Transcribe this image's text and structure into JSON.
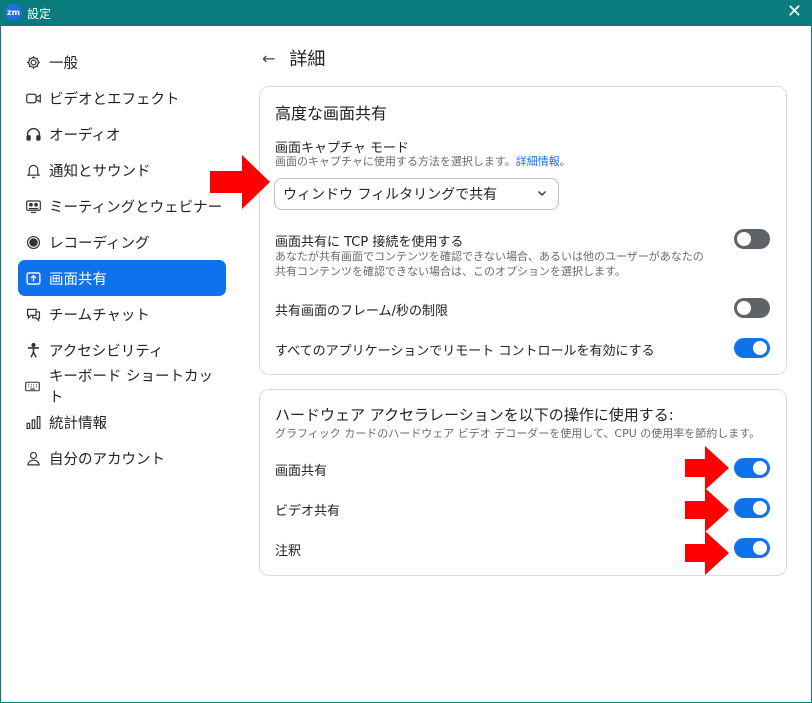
{
  "window": {
    "title": "設定",
    "logo": "zm",
    "close_glyph": "✕"
  },
  "sidebar": {
    "items": [
      {
        "label": "一般",
        "icon": "gear-icon",
        "active": false
      },
      {
        "label": "ビデオとエフェクト",
        "icon": "video-camera-icon",
        "active": false
      },
      {
        "label": "オーディオ",
        "icon": "headphones-icon",
        "active": false
      },
      {
        "label": "通知とサウンド",
        "icon": "bell-icon",
        "active": false
      },
      {
        "label": "ミーティングとウェビナー",
        "icon": "meeting-icon",
        "active": false
      },
      {
        "label": "レコーディング",
        "icon": "record-icon",
        "active": false
      },
      {
        "label": "画面共有",
        "icon": "share-screen-icon",
        "active": true
      },
      {
        "label": "チームチャット",
        "icon": "chat-icon",
        "active": false
      },
      {
        "label": "アクセシビリティ",
        "icon": "accessibility-icon",
        "active": false
      },
      {
        "label": "キーボード ショートカット",
        "icon": "keyboard-icon",
        "active": false
      },
      {
        "label": "統計情報",
        "icon": "stats-icon",
        "active": false
      },
      {
        "label": "自分のアカウント",
        "icon": "user-icon",
        "active": false
      }
    ]
  },
  "header": {
    "back_glyph": "←",
    "title": "詳細"
  },
  "advanced": {
    "title": "高度な画面共有",
    "capture_mode_label": "画面キャプチャ モード",
    "capture_mode_desc": "画面のキャプチャに使用する方法を選択します。",
    "capture_mode_link": "詳細情報",
    "capture_mode_period": "。",
    "capture_mode_value": "ウィンドウ フィルタリングで共有",
    "tcp_label": "画面共有に TCP 接続を使用する",
    "tcp_desc_line1": "あなたが共有画面でコンテンツを確認できない場合、あるいは他のユーザーがあなたの",
    "tcp_desc_line2": "共有コンテンツを確認できない場合は、このオプションを選択します。",
    "tcp_on": false,
    "fps_label": "共有画面のフレーム/秒の制限",
    "fps_on": false,
    "remote_label": "すべてのアプリケーションでリモート コントロールを有効にする",
    "remote_on": true
  },
  "hardware": {
    "title": "ハードウェア アクセラレーションを以下の操作に使用する:",
    "desc": "グラフィック カードのハードウェア ビデオ デコーダーを使用して、CPU の使用率を節約します。",
    "screen_share_label": "画面共有",
    "screen_share_on": true,
    "video_share_label": "ビデオ共有",
    "video_share_on": true,
    "annotation_label": "注釈",
    "annotation_on": true
  },
  "colors": {
    "accent": "#0e72ed",
    "titlebar": "#0a7b7c",
    "toggle_off": "#5f6368",
    "annotation_arrow": "#ff0000"
  }
}
